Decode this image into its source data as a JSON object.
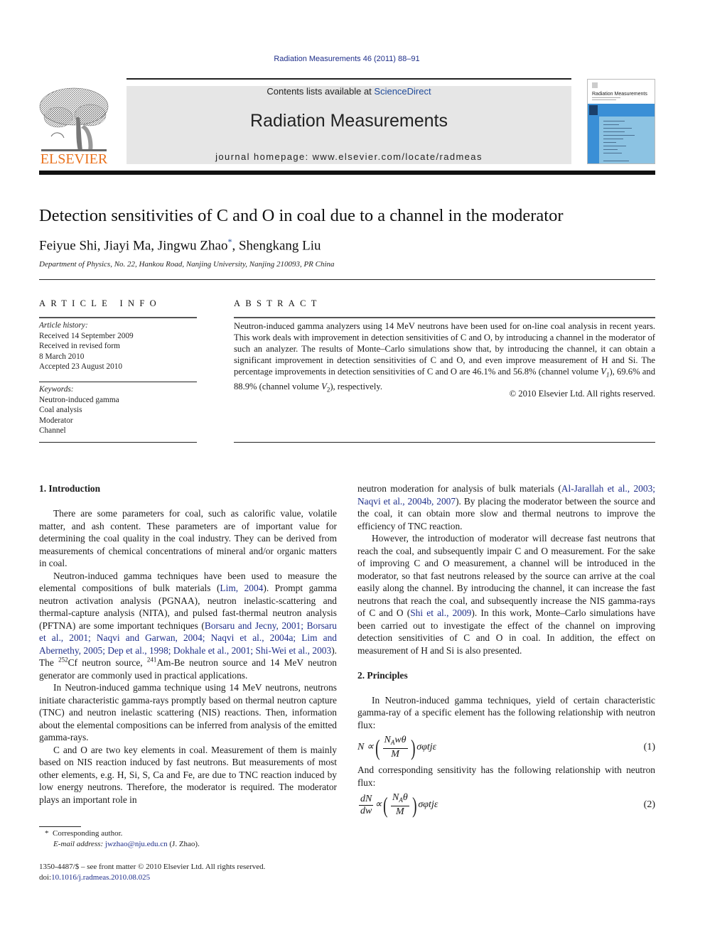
{
  "header": {
    "journal_ref": "Radiation Measurements 46 (2011) 88–91",
    "contents_prefix": "Contents lists available at ",
    "contents_link": "ScienceDirect",
    "journal_name": "Radiation Measurements",
    "homepage": "journal homepage: www.elsevier.com/locate/radmeas",
    "publisher_logo_text": "ELSEVIER",
    "cover_title": "Radiation Measurements",
    "colors": {
      "logo_orange": "#e9711c",
      "link_blue": "#1f2f8a",
      "cover_blue": "#3a8fd6",
      "cover_light_blue": "#8cc3e3",
      "banner_grey": "#e6e6e6"
    }
  },
  "article": {
    "title": "Detection sensitivities of C and O in coal due to a channel in the moderator",
    "authors": "Feiyue Shi, Jiayi Ma, Jingwu Zhao",
    "authors_marker": "*",
    "authors_tail": ", Shengkang Liu",
    "affiliation": "Department of Physics, No. 22, Hankou Road, Nanjing University, Nanjing 210093, PR China"
  },
  "article_info": {
    "heading": "ARTICLE INFO",
    "history_label": "Article history:",
    "history": [
      "Received 14 September 2009",
      "Received in revised form",
      "8 March 2010",
      "Accepted 23 August 2010"
    ],
    "keywords_label": "Keywords:",
    "keywords": [
      "Neutron-induced gamma",
      "Coal analysis",
      "Moderator",
      "Channel"
    ]
  },
  "abstract": {
    "heading": "ABSTRACT",
    "text_1": "Neutron-induced gamma analyzers using 14 MeV neutrons have been used for on-line coal analysis in recent years. This work deals with improvement in detection sensitivities of C and O, by introducing a channel in the moderator of such an analyzer. The results of Monte–Carlo simulations show that, by introducing the channel, it can obtain a significant improvement in detection sensitivities of C and O, and even improve measurement of H and Si. The percentage improvements in detection sensitivities of C and O are 46.1% and 56.8% (channel volume ",
    "v1": "V",
    "v1_sub": "1",
    "text_2": "), 69.6% and 88.9% (channel volume ",
    "v2": "V",
    "v2_sub": "2",
    "text_3": "), respectively.",
    "copyright": "© 2010 Elsevier Ltd. All rights reserved."
  },
  "body": {
    "intro_heading": "1.  Introduction",
    "intro_p1": "There are some parameters for coal, such as calorific value, volatile matter, and ash content. These parameters are of important value for determining the coal quality in the coal industry. They can be derived from measurements of chemical concentrations of mineral and/or organic matters in coal.",
    "intro_p2_a": "Neutron-induced gamma techniques have been used to measure the elemental compositions of bulk materials (",
    "intro_p2_ref1": "Lim, 2004",
    "intro_p2_b": "). Prompt gamma neutron activation analysis (PGNAA), neutron inelastic-scattering and thermal-capture analysis (NITA), and pulsed fast-thermal neutron analysis (PFTNA) are some important techniques (",
    "intro_p2_ref2": "Borsaru and Jecny, 2001; Borsaru et al., 2001; Naqvi and Garwan, 2004; Naqvi et al., 2004a; Lim and Abernethy, 2005; Dep et al., 1998; Dokhale et al., 2001; Shi-Wei et al., 2003",
    "intro_p2_c": "). The ",
    "intro_p2_sup1": "252",
    "intro_p2_d": "Cf neutron source, ",
    "intro_p2_sup2": "241",
    "intro_p2_e": "Am-Be neutron source and 14 MeV neutron generator are commonly used in practical applications.",
    "intro_p3": "In Neutron-induced gamma technique using 14 MeV neutrons, neutrons initiate characteristic gamma-rays promptly based on thermal neutron capture (TNC) and neutron inelastic scattering (NIS) reactions. Then, information about the elemental compositions can be inferred from analysis of the emitted gamma-rays.",
    "intro_p4": "C and O are two key elements in coal. Measurement of them is mainly based on NIS reaction induced by fast neutrons. But measurements of most other elements, e.g. H, Si, S, Ca and Fe, are due to TNC reaction induced by low energy neutrons. Therefore, the moderator is required. The moderator plays an important role in",
    "right_p1_a": "neutron moderation for analysis of bulk materials (",
    "right_p1_ref": "Al-Jarallah et al., 2003; Naqvi et al., 2004b, 2007",
    "right_p1_b": "). By placing the moderator between the source and the coal, it can obtain more slow and thermal neutrons to improve the efficiency of TNC reaction.",
    "right_p2_a": "However, the introduction of moderator will decrease fast neutrons that reach the coal, and subsequently impair C and O measurement. For the sake of improving C and O measurement, a channel will be introduced in the moderator, so that fast neutrons released by the source can arrive at the coal easily along the channel. By introducing the channel, it can increase the fast neutrons that reach the coal, and subsequently increase the NIS gamma-rays of C and O (",
    "right_p2_ref": "Shi et al., 2009",
    "right_p2_b": "). In this work, Monte–Carlo simulations have been carried out to investigate the effect of the channel on improving detection sensitivities of C and O in coal. In addition, the effect on measurement of H and Si is also presented.",
    "principles_heading": "2.  Principles",
    "principles_p1": "In Neutron-induced gamma techniques, yield of certain characteristic gamma-ray of a specific element has the following relationship with neutron flux:",
    "eq1": {
      "lhs": "N ∝ ",
      "num_a": "N",
      "num_sub": "A",
      "num_b": "wθ",
      "den": "M",
      "rhs": "σφtjε",
      "label": "(1)"
    },
    "between_eq": "And corresponding sensitivity has the following relationship with neutron flux:",
    "eq2": {
      "lhs_num": "dN",
      "lhs_den": "dw",
      "prop": "∝ ",
      "num_a": "N",
      "num_sub": "A",
      "num_b": "θ",
      "den": "M",
      "rhs": "σφtjε",
      "label": "(2)"
    }
  },
  "footnote": {
    "marker": "*",
    "corresponding": "Corresponding author.",
    "email_label": "E-mail address: ",
    "email": "jwzhao@nju.edu.cn",
    "email_tail": " (J. Zhao)."
  },
  "front_matter": {
    "line1": "1350-4487/$ – see front matter © 2010 Elsevier Ltd. All rights reserved.",
    "doi_label": "doi:",
    "doi": "10.1016/j.radmeas.2010.08.025"
  }
}
